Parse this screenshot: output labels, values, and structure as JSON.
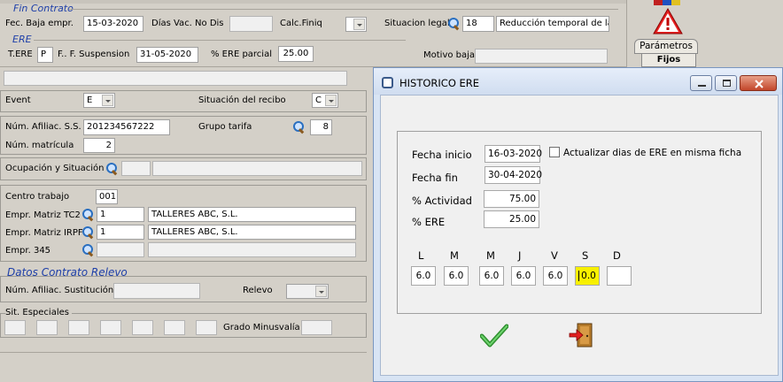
{
  "fin_contrato": {
    "title": "Fin Contrato",
    "fec_baja_label": "Fec. Baja empr.",
    "fec_baja_value": "15-03-2020",
    "dias_vac_label": "Días Vac. No Dis",
    "calc_finiq_label": "Calc.Finiq",
    "situacion_legal_label": "Situacion legal",
    "situacion_legal_code": "18",
    "situacion_legal_desc": "Reducción temporal de la j"
  },
  "ere": {
    "title": "ERE",
    "tere_label": "T.ERE",
    "tere_value": "P",
    "ff_suspension_label": "F.. F. Suspension",
    "ff_suspension_value": "31-05-2020",
    "ere_parcial_label": "% ERE parcial",
    "ere_parcial_value": "25.00",
    "motivo_baja_label": "Motivo baja"
  },
  "side": {
    "parametros_tab": "Parámetros",
    "fijos_button": "Fijos"
  },
  "event": {
    "event_label": "Event",
    "event_value": "E",
    "situacion_recibo_label": "Situación del recibo",
    "situacion_recibo_value": "C"
  },
  "afiliacion": {
    "num_afiliac_label": "Núm. Afiliac. S.S.",
    "num_afiliac_value": "201234567222",
    "grupo_tarifa_label": "Grupo tarifa",
    "grupo_tarifa_value": "8",
    "num_matricula_label": "Núm. matrícula",
    "num_matricula_value": "2"
  },
  "ocupacion": {
    "label": "Ocupación y Situación"
  },
  "centro": {
    "centro_trabajo_label": "Centro trabajo",
    "centro_trabajo_value": "001",
    "matriz_tc2_label": "Empr. Matriz TC2",
    "matriz_tc2_code": "1",
    "matriz_tc2_name": "TALLERES ABC, S.L.",
    "matriz_irpf_label": "Empr. Matriz IRPF",
    "matriz_irpf_code": "1",
    "matriz_irpf_name": "TALLERES ABC, S.L.",
    "empr345_label": "Empr. 345"
  },
  "relevo": {
    "title": "Datos Contrato Relevo",
    "num_sustitucion_label": "Núm. Afiliac. Sustitución",
    "relevo_label": "Relevo"
  },
  "especiales": {
    "title": "Sit. Especiales",
    "grado_label": "Grado Minusvalía"
  },
  "dialog": {
    "title": "HISTORICO ERE",
    "fecha_inicio_label": "Fecha inicio",
    "fecha_inicio_value": "16-03-2020",
    "actualizar_label": "Actualizar dias de ERE  en misma ficha",
    "fecha_fin_label": "Fecha fin",
    "fecha_fin_value": "30-04-2020",
    "actividad_label": "% Actividad",
    "actividad_value": "75.00",
    "ere_label": "% ERE",
    "ere_value": "25.00",
    "days": [
      {
        "label": "L",
        "value": "6.0"
      },
      {
        "label": "M",
        "value": "6.0"
      },
      {
        "label": "M",
        "value": "6.0"
      },
      {
        "label": "J",
        "value": "6.0"
      },
      {
        "label": "V",
        "value": "6.0"
      },
      {
        "label": "S",
        "value": "0.0"
      },
      {
        "label": "D",
        "value": ""
      }
    ],
    "icons": {
      "accept": "checkmark-icon",
      "exit": "exit-door-icon"
    },
    "colors": {
      "accept_green": "#3cb043",
      "highlight_yellow": "#f8f000",
      "title_blue": "#1e3fa8"
    }
  }
}
